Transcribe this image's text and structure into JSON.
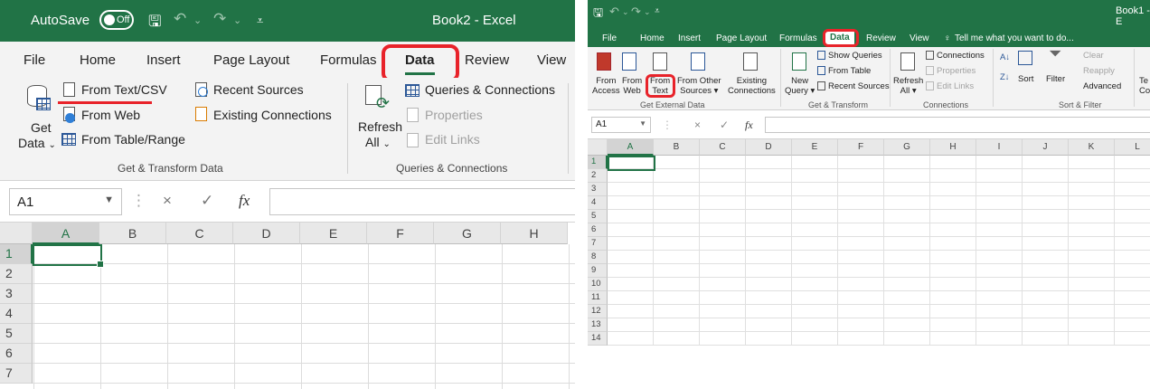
{
  "left": {
    "title_bar": {
      "autosave_label": "AutoSave",
      "autosave_state": "Off",
      "workbook_title": "Book2 - Excel",
      "bg": "#217346"
    },
    "tabs": [
      {
        "label": "File"
      },
      {
        "label": "Home"
      },
      {
        "label": "Insert"
      },
      {
        "label": "Page Layout"
      },
      {
        "label": "Formulas"
      },
      {
        "label": "Data"
      },
      {
        "label": "Review"
      },
      {
        "label": "View"
      }
    ],
    "active_tab": "Data",
    "ribbon": {
      "get_data": "Get Data",
      "get_data_line1": "Get",
      "get_data_line2": "Data",
      "from_text_csv": "From Text/CSV",
      "from_web": "From Web",
      "from_table_range": "From Table/Range",
      "recent_sources": "Recent Sources",
      "existing_connections": "Existing Connections",
      "refresh_line1": "Refresh",
      "refresh_line2": "All",
      "queries_connections": "Queries & Connections",
      "properties": "Properties",
      "edit_links": "Edit Links",
      "group_get_transform": "Get & Transform Data",
      "group_queries": "Queries & Connections"
    },
    "formula_bar": {
      "name_box": "A1",
      "fx": "fx",
      "cancel": "×",
      "enter": "✓"
    },
    "grid": {
      "columns": [
        "A",
        "B",
        "C",
        "D",
        "E",
        "F",
        "G",
        "H"
      ],
      "rows": [
        "1",
        "2",
        "3",
        "4",
        "5",
        "6",
        "7"
      ],
      "active_cell": "A1"
    }
  },
  "right": {
    "title_bar": {
      "workbook_title": "Book1 - E"
    },
    "tabs": [
      {
        "label": "File"
      },
      {
        "label": "Home"
      },
      {
        "label": "Insert"
      },
      {
        "label": "Page Layout"
      },
      {
        "label": "Formulas"
      },
      {
        "label": "Data"
      },
      {
        "label": "Review"
      },
      {
        "label": "View"
      }
    ],
    "tell_me": "Tell me what you want to do...",
    "ribbon": {
      "from_access_1": "From",
      "from_access_2": "Access",
      "from_web_1": "From",
      "from_web_2": "Web",
      "from_text_1": "From",
      "from_text_2": "Text",
      "from_other_1": "From Other",
      "from_other_2": "Sources",
      "existing_1": "Existing",
      "existing_2": "Connections",
      "new_query_1": "New",
      "new_query_2": "Query",
      "show_queries": "Show Queries",
      "from_table": "From Table",
      "recent_sources": "Recent Sources",
      "refresh_1": "Refresh",
      "refresh_2": "All",
      "connections": "Connections",
      "properties": "Properties",
      "edit_links": "Edit Links",
      "sort": "Sort",
      "filter": "Filter",
      "clear": "Clear",
      "reapply": "Reapply",
      "advanced": "Advanced",
      "text_to_cols_1": "Te",
      "text_to_cols_2": "Co",
      "group_external": "Get External Data",
      "group_get_transform": "Get & Transform",
      "group_connections": "Connections",
      "group_sort_filter": "Sort & Filter"
    },
    "formula_bar": {
      "name_box": "A1",
      "fx": "fx",
      "cancel": "×",
      "enter": "✓"
    },
    "grid": {
      "columns": [
        "A",
        "B",
        "C",
        "D",
        "E",
        "F",
        "G",
        "H",
        "I",
        "J",
        "K",
        "L"
      ],
      "rows": [
        "1",
        "2",
        "3",
        "4",
        "5",
        "6",
        "7",
        "8",
        "9",
        "10",
        "11",
        "12",
        "13",
        "14"
      ],
      "active_cell": "A1"
    }
  },
  "colors": {
    "excel_green": "#217346",
    "annotation_red": "#e8232a"
  }
}
